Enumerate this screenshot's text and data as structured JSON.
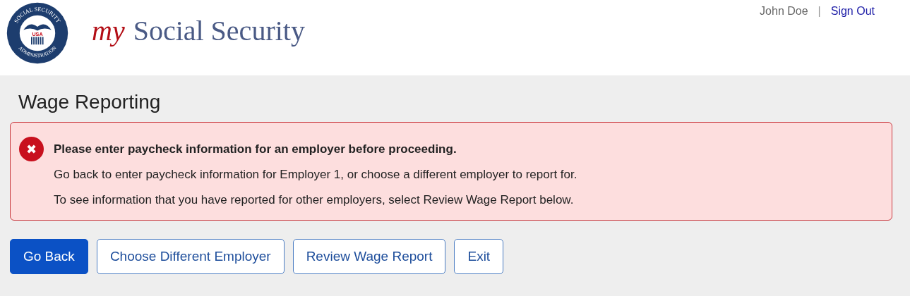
{
  "header": {
    "seal": {
      "top_text": "SOCIAL SECURITY",
      "bottom_text": "ADMINISTRATION",
      "center_text": "USA"
    },
    "brand_prefix": "my",
    "brand_name": "Social Security",
    "user_name": "John Doe",
    "separator": "|",
    "sign_out": "Sign Out"
  },
  "page_title": "Wage Reporting",
  "alert": {
    "kind": "error",
    "icon": "✖",
    "heading": "Please enter paycheck information for an employer before proceeding.",
    "messages": [
      "Go back to enter paycheck information for Employer 1, or choose a different employer to report for.",
      "To see information that you have reported for other employers, select Review Wage Report below."
    ]
  },
  "buttons": [
    {
      "label": "Go Back",
      "kind": "primary"
    },
    {
      "label": "Choose Different Employer",
      "kind": "secondary"
    },
    {
      "label": "Review Wage Report",
      "kind": "secondary"
    },
    {
      "label": "Exit",
      "kind": "secondary"
    }
  ]
}
